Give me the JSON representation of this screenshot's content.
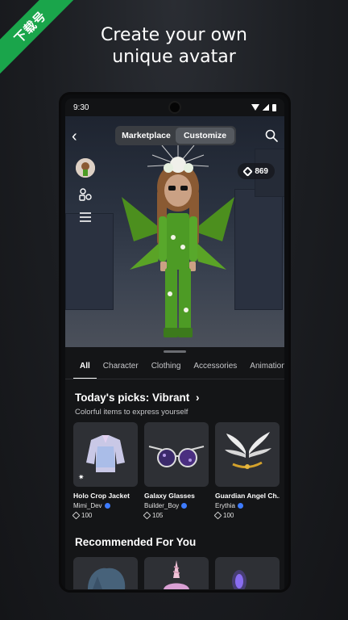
{
  "promo": {
    "ribbon_text": "下载号",
    "headline_line1": "Create your own",
    "headline_line2": "unique avatar"
  },
  "status_bar": {
    "time": "9:30"
  },
  "header": {
    "segments": [
      {
        "label": "Marketplace",
        "active": false
      },
      {
        "label": "Customize",
        "active": true
      }
    ]
  },
  "robux_balance": "869",
  "tabs": [
    {
      "label": "All",
      "active": true
    },
    {
      "label": "Character",
      "active": false
    },
    {
      "label": "Clothing",
      "active": false
    },
    {
      "label": "Accessories",
      "active": false
    },
    {
      "label": "Animation",
      "active": false
    }
  ],
  "todays_picks": {
    "title": "Today's picks: Vibrant",
    "chevron": "›",
    "subtitle": "Colorful items to express yourself",
    "items": [
      {
        "name": "Holo Crop Jacket",
        "creator": "Mimi_Dev",
        "price": "100",
        "icon": "sparkle-icon"
      },
      {
        "name": "Galaxy Glasses",
        "creator": "Builder_Boy",
        "price": "105"
      },
      {
        "name": "Guardian Angel Ch...",
        "creator": "Erythia",
        "price": "100"
      }
    ]
  },
  "recommended": {
    "title": "Recommended For You"
  },
  "colors": {
    "ribbon": "#1aa54b",
    "verified": "#3d7bff",
    "background": "#1b1d21"
  }
}
